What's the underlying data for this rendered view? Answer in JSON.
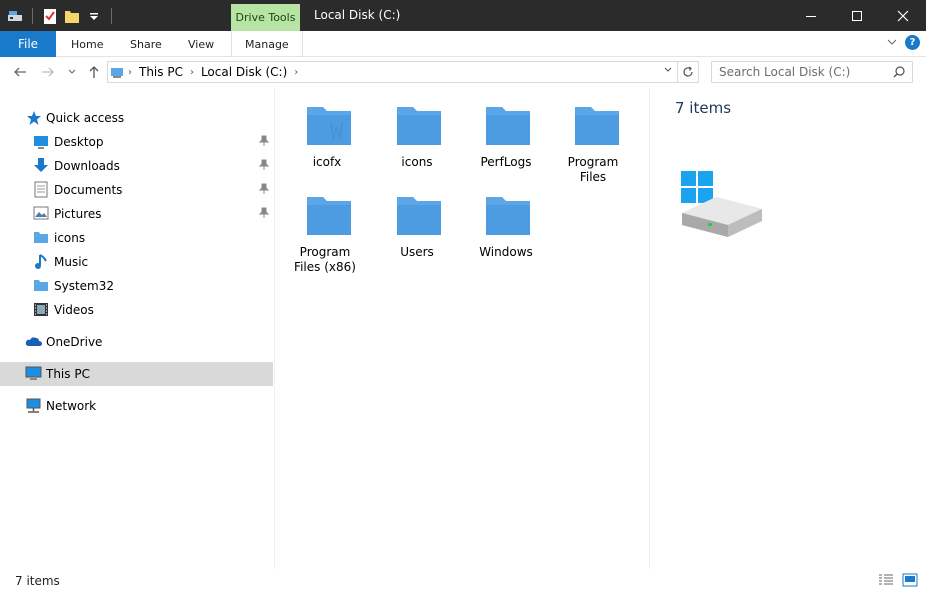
{
  "titlebar": {
    "contextual_tab": "Drive Tools",
    "title": "Local Disk (C:)",
    "minimize_icon": "minimize-icon",
    "maximize_icon": "maximize-icon",
    "close_icon": "close-icon"
  },
  "ribbon": {
    "file": "File",
    "home": "Home",
    "share": "Share",
    "view": "View",
    "manage": "Manage"
  },
  "address": {
    "crumbs": [
      "This PC",
      "Local Disk (C:)"
    ],
    "search_placeholder": "Search Local Disk (C:)"
  },
  "nav": {
    "quick_access": "Quick access",
    "items": [
      {
        "label": "Desktop",
        "icon": "desktop-icon",
        "pinned": true
      },
      {
        "label": "Downloads",
        "icon": "downloads-icon",
        "pinned": true
      },
      {
        "label": "Documents",
        "icon": "documents-icon",
        "pinned": true
      },
      {
        "label": "Pictures",
        "icon": "pictures-icon",
        "pinned": true
      },
      {
        "label": "icons",
        "icon": "folder-icon",
        "pinned": false
      },
      {
        "label": "Music",
        "icon": "music-icon",
        "pinned": false
      },
      {
        "label": "System32",
        "icon": "folder-icon",
        "pinned": false
      },
      {
        "label": "Videos",
        "icon": "videos-icon",
        "pinned": false
      }
    ],
    "onedrive": "OneDrive",
    "this_pc": "This PC",
    "network": "Network"
  },
  "content": {
    "folders": [
      "icofx",
      "icons",
      "PerfLogs",
      "Program Files",
      "Program Files (x86)",
      "Users",
      "Windows"
    ]
  },
  "preview": {
    "count": "7 items",
    "icon": "hard-drive-icon"
  },
  "status": {
    "count": "7 items"
  },
  "colors": {
    "file_tab": "#1979ca",
    "drive_tools": "#b7e3a4",
    "titlebar": "#2b2b2b",
    "folder": "#5aa6e6",
    "selected": "#d9d9d9"
  }
}
